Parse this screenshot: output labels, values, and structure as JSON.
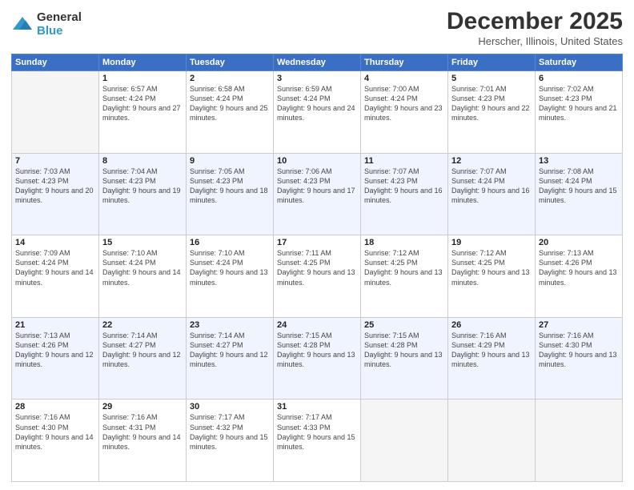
{
  "logo": {
    "general": "General",
    "blue": "Blue"
  },
  "header": {
    "month": "December 2025",
    "location": "Herscher, Illinois, United States"
  },
  "weekdays": [
    "Sunday",
    "Monday",
    "Tuesday",
    "Wednesday",
    "Thursday",
    "Friday",
    "Saturday"
  ],
  "weeks": [
    [
      {
        "day": null
      },
      {
        "day": "1",
        "sunrise": "Sunrise: 6:57 AM",
        "sunset": "Sunset: 4:24 PM",
        "daylight": "Daylight: 9 hours and 27 minutes."
      },
      {
        "day": "2",
        "sunrise": "Sunrise: 6:58 AM",
        "sunset": "Sunset: 4:24 PM",
        "daylight": "Daylight: 9 hours and 25 minutes."
      },
      {
        "day": "3",
        "sunrise": "Sunrise: 6:59 AM",
        "sunset": "Sunset: 4:24 PM",
        "daylight": "Daylight: 9 hours and 24 minutes."
      },
      {
        "day": "4",
        "sunrise": "Sunrise: 7:00 AM",
        "sunset": "Sunset: 4:24 PM",
        "daylight": "Daylight: 9 hours and 23 minutes."
      },
      {
        "day": "5",
        "sunrise": "Sunrise: 7:01 AM",
        "sunset": "Sunset: 4:23 PM",
        "daylight": "Daylight: 9 hours and 22 minutes."
      },
      {
        "day": "6",
        "sunrise": "Sunrise: 7:02 AM",
        "sunset": "Sunset: 4:23 PM",
        "daylight": "Daylight: 9 hours and 21 minutes."
      }
    ],
    [
      {
        "day": "7",
        "sunrise": "Sunrise: 7:03 AM",
        "sunset": "Sunset: 4:23 PM",
        "daylight": "Daylight: 9 hours and 20 minutes."
      },
      {
        "day": "8",
        "sunrise": "Sunrise: 7:04 AM",
        "sunset": "Sunset: 4:23 PM",
        "daylight": "Daylight: 9 hours and 19 minutes."
      },
      {
        "day": "9",
        "sunrise": "Sunrise: 7:05 AM",
        "sunset": "Sunset: 4:23 PM",
        "daylight": "Daylight: 9 hours and 18 minutes."
      },
      {
        "day": "10",
        "sunrise": "Sunrise: 7:06 AM",
        "sunset": "Sunset: 4:23 PM",
        "daylight": "Daylight: 9 hours and 17 minutes."
      },
      {
        "day": "11",
        "sunrise": "Sunrise: 7:07 AM",
        "sunset": "Sunset: 4:23 PM",
        "daylight": "Daylight: 9 hours and 16 minutes."
      },
      {
        "day": "12",
        "sunrise": "Sunrise: 7:07 AM",
        "sunset": "Sunset: 4:24 PM",
        "daylight": "Daylight: 9 hours and 16 minutes."
      },
      {
        "day": "13",
        "sunrise": "Sunrise: 7:08 AM",
        "sunset": "Sunset: 4:24 PM",
        "daylight": "Daylight: 9 hours and 15 minutes."
      }
    ],
    [
      {
        "day": "14",
        "sunrise": "Sunrise: 7:09 AM",
        "sunset": "Sunset: 4:24 PM",
        "daylight": "Daylight: 9 hours and 14 minutes."
      },
      {
        "day": "15",
        "sunrise": "Sunrise: 7:10 AM",
        "sunset": "Sunset: 4:24 PM",
        "daylight": "Daylight: 9 hours and 14 minutes."
      },
      {
        "day": "16",
        "sunrise": "Sunrise: 7:10 AM",
        "sunset": "Sunset: 4:24 PM",
        "daylight": "Daylight: 9 hours and 13 minutes."
      },
      {
        "day": "17",
        "sunrise": "Sunrise: 7:11 AM",
        "sunset": "Sunset: 4:25 PM",
        "daylight": "Daylight: 9 hours and 13 minutes."
      },
      {
        "day": "18",
        "sunrise": "Sunrise: 7:12 AM",
        "sunset": "Sunset: 4:25 PM",
        "daylight": "Daylight: 9 hours and 13 minutes."
      },
      {
        "day": "19",
        "sunrise": "Sunrise: 7:12 AM",
        "sunset": "Sunset: 4:25 PM",
        "daylight": "Daylight: 9 hours and 13 minutes."
      },
      {
        "day": "20",
        "sunrise": "Sunrise: 7:13 AM",
        "sunset": "Sunset: 4:26 PM",
        "daylight": "Daylight: 9 hours and 13 minutes."
      }
    ],
    [
      {
        "day": "21",
        "sunrise": "Sunrise: 7:13 AM",
        "sunset": "Sunset: 4:26 PM",
        "daylight": "Daylight: 9 hours and 12 minutes."
      },
      {
        "day": "22",
        "sunrise": "Sunrise: 7:14 AM",
        "sunset": "Sunset: 4:27 PM",
        "daylight": "Daylight: 9 hours and 12 minutes."
      },
      {
        "day": "23",
        "sunrise": "Sunrise: 7:14 AM",
        "sunset": "Sunset: 4:27 PM",
        "daylight": "Daylight: 9 hours and 12 minutes."
      },
      {
        "day": "24",
        "sunrise": "Sunrise: 7:15 AM",
        "sunset": "Sunset: 4:28 PM",
        "daylight": "Daylight: 9 hours and 13 minutes."
      },
      {
        "day": "25",
        "sunrise": "Sunrise: 7:15 AM",
        "sunset": "Sunset: 4:28 PM",
        "daylight": "Daylight: 9 hours and 13 minutes."
      },
      {
        "day": "26",
        "sunrise": "Sunrise: 7:16 AM",
        "sunset": "Sunset: 4:29 PM",
        "daylight": "Daylight: 9 hours and 13 minutes."
      },
      {
        "day": "27",
        "sunrise": "Sunrise: 7:16 AM",
        "sunset": "Sunset: 4:30 PM",
        "daylight": "Daylight: 9 hours and 13 minutes."
      }
    ],
    [
      {
        "day": "28",
        "sunrise": "Sunrise: 7:16 AM",
        "sunset": "Sunset: 4:30 PM",
        "daylight": "Daylight: 9 hours and 14 minutes."
      },
      {
        "day": "29",
        "sunrise": "Sunrise: 7:16 AM",
        "sunset": "Sunset: 4:31 PM",
        "daylight": "Daylight: 9 hours and 14 minutes."
      },
      {
        "day": "30",
        "sunrise": "Sunrise: 7:17 AM",
        "sunset": "Sunset: 4:32 PM",
        "daylight": "Daylight: 9 hours and 15 minutes."
      },
      {
        "day": "31",
        "sunrise": "Sunrise: 7:17 AM",
        "sunset": "Sunset: 4:33 PM",
        "daylight": "Daylight: 9 hours and 15 minutes."
      },
      {
        "day": null
      },
      {
        "day": null
      },
      {
        "day": null
      }
    ]
  ]
}
